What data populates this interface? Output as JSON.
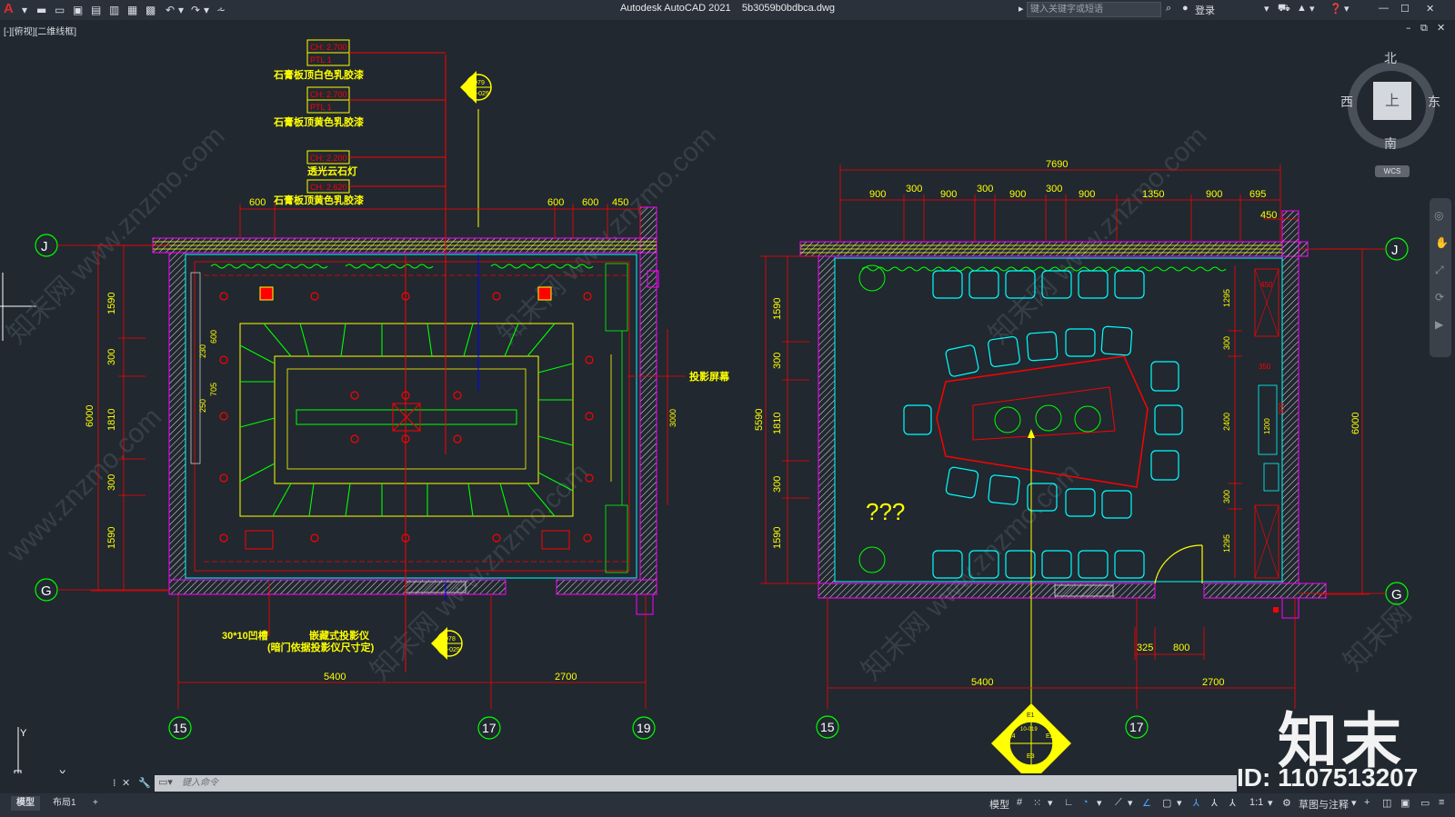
{
  "app": {
    "logo": "A",
    "title": "Autodesk AutoCAD 2021",
    "file_name": "5b3059b0bdbca.dwg"
  },
  "titlebar": {
    "search_placeholder": "键入关键字或短语",
    "login_label": "登录",
    "quick_icons": [
      "new-icon",
      "open-icon",
      "save-icon",
      "save-as-icon",
      "plot-preview-icon",
      "publish-icon",
      "print-icon",
      "undo-icon",
      "redo-icon",
      "customize-icon"
    ]
  },
  "viewport": {
    "label": "[-][俯视][二维线框]"
  },
  "viewcube": {
    "north": "北",
    "south": "南",
    "east": "东",
    "west": "西",
    "face": "上",
    "wcs": "WCS"
  },
  "left_plan": {
    "labels": [
      {
        "id": "lbl1",
        "text": "石膏板顶白色乳胶漆",
        "tag1": "CH: 2.700",
        "tag2": "PTL 1"
      },
      {
        "id": "lbl2",
        "text": "石膏板顶黄色乳胶漆",
        "tag1": "CH: 2.700",
        "tag2": "PTL 1"
      },
      {
        "id": "lbl3",
        "text": "透光云石灯",
        "tag1": "CH: 2.200",
        "tag2": ""
      },
      {
        "id": "lbl4",
        "text": "石膏板顶黄色乳胶漆",
        "tag1": "CH: 2.620",
        "tag2": ""
      }
    ],
    "top_dims": [
      "600",
      "600",
      "600",
      "450"
    ],
    "left_dims": [
      "1590",
      "300",
      "1810",
      "300",
      "1590"
    ],
    "overall_left": "6000",
    "inner_dims": [
      "600",
      "705",
      "250",
      "230"
    ],
    "screen_label": "投影屏幕",
    "screen_dim": "3000",
    "bottom_dims": [
      "5400",
      "2700"
    ],
    "bottom_note1": "30*10凹槽",
    "bottom_note2": "嵌藏式投影仪",
    "bottom_note3": "(暗门依据投影仪尺寸定)",
    "callout_top": {
      "code": "D79",
      "ref": "10-029"
    },
    "callout_bottom": {
      "code": "D78",
      "ref": "10-029"
    }
  },
  "right_plan": {
    "overall_top": "7690",
    "top_dims": [
      "900",
      "300",
      "900",
      "300",
      "900",
      "300",
      "900",
      "1350",
      "900",
      "695",
      "450"
    ],
    "left_dims": [
      "1590",
      "300",
      "1810",
      "300",
      "1590"
    ],
    "overall_left": "5590",
    "right_dims": [
      "1295",
      "300",
      "2400",
      "300",
      "1295"
    ],
    "overall_right": "6000",
    "cab_dims": [
      "450",
      "350",
      "1200",
      "900"
    ],
    "question": "???",
    "door_dims": [
      "325",
      "800"
    ],
    "bottom_dims": [
      "5400",
      "2700"
    ],
    "elev_tags": [
      "E1",
      "E2",
      "E3",
      "E4"
    ],
    "elev_ref": "10-019"
  },
  "grid": {
    "rows": [
      "J",
      "G"
    ],
    "cols_left": [
      "15",
      "17",
      "19"
    ],
    "cols_right": [
      "15",
      "17"
    ]
  },
  "watermark": {
    "site": "www.znzmo.com",
    "site_cn": "知末网",
    "logo": "知末",
    "id": "ID: 1107513207"
  },
  "command": {
    "placeholder": "键入命令"
  },
  "status": {
    "tabs": [
      "模型",
      "布局1"
    ],
    "add_tab": "+",
    "model_label": "模型",
    "scale": "1:1",
    "workspace": "草图与注释"
  },
  "colors": {
    "background": "#212830",
    "wall": "#ff00ff",
    "red": "#ff0000",
    "green": "#00ff00",
    "yellow": "#ffff00",
    "cyan": "#00ffff"
  }
}
